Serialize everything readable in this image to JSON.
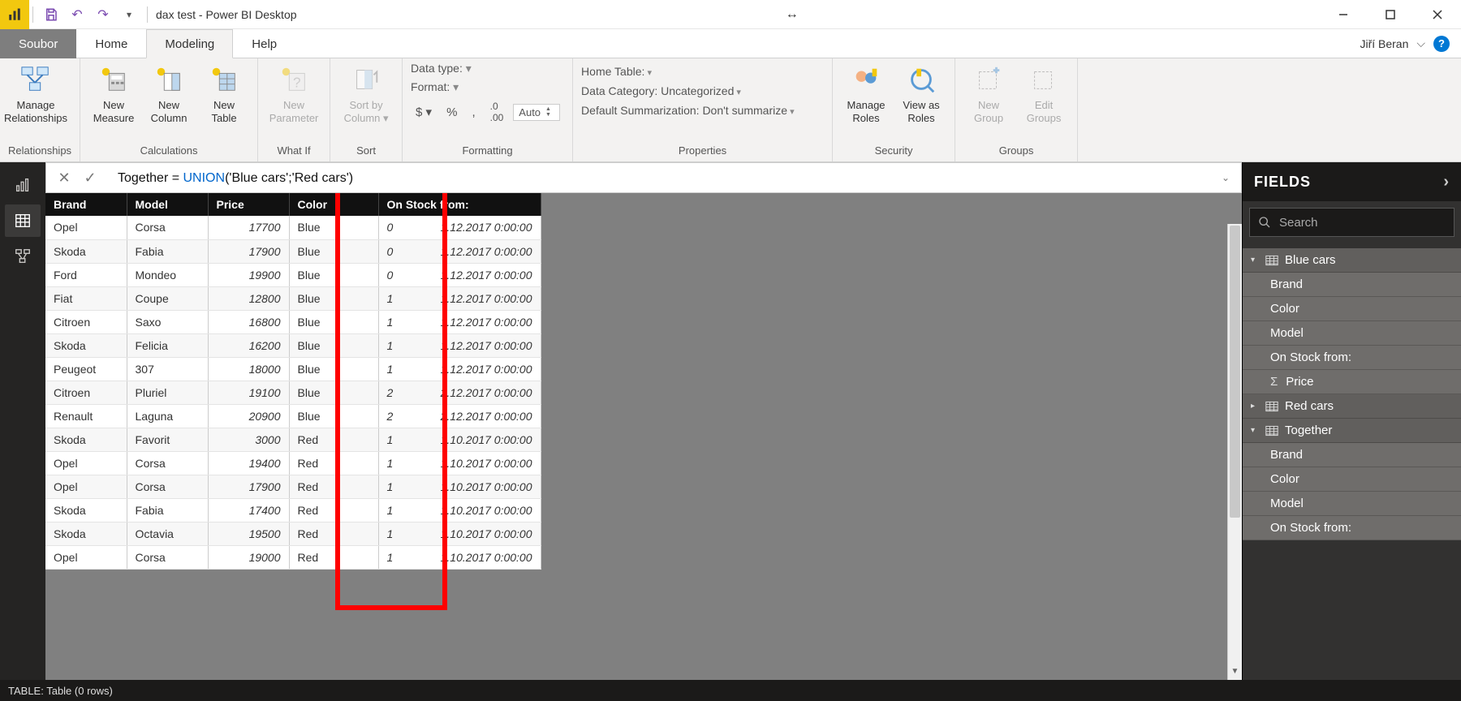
{
  "title": "dax test - Power BI Desktop",
  "user": "Jiří Beran",
  "tabs": {
    "file": "Soubor",
    "home": "Home",
    "modeling": "Modeling",
    "help": "Help"
  },
  "ribbon": {
    "relationships": {
      "manage": "Manage\nRelationships",
      "group": "Relationships"
    },
    "calc": {
      "measure": "New\nMeasure",
      "column": "New\nColumn",
      "table": "New\nTable",
      "group": "Calculations"
    },
    "whatif": {
      "param": "New\nParameter",
      "group": "What If"
    },
    "sort": {
      "btn": "Sort by\nColumn ▾",
      "group": "Sort"
    },
    "formatting": {
      "datatype": "Data type:",
      "format": "Format:",
      "auto": "Auto",
      "group": "Formatting"
    },
    "properties": {
      "hometable": "Home Table:",
      "datacat": "Data Category: Uncategorized",
      "summ": "Default Summarization: Don't summarize",
      "group": "Properties"
    },
    "security": {
      "roles": "Manage\nRoles",
      "viewas": "View as\nRoles",
      "group": "Security"
    },
    "groups": {
      "new": "New\nGroup",
      "edit": "Edit\nGroups",
      "group": "Groups"
    }
  },
  "formula": {
    "prefix": "Together = ",
    "func": "UNION",
    "args": "('Blue cars';'Red cars')"
  },
  "columns": [
    "Brand",
    "Model",
    "Price",
    "Color",
    "On Stock from:"
  ],
  "rows": [
    [
      "Opel",
      "Corsa",
      "17700",
      "Blue",
      "0",
      "1",
      "12.2017 0:00:00"
    ],
    [
      "Skoda",
      "Fabia",
      "17900",
      "Blue",
      "0",
      "1",
      "12.2017 0:00:00"
    ],
    [
      "Ford",
      "Mondeo",
      "19900",
      "Blue",
      "0",
      "1",
      "12.2017 0:00:00"
    ],
    [
      "Fiat",
      "Coupe",
      "12800",
      "Blue",
      "1",
      "1",
      "12.2017 0:00:00"
    ],
    [
      "Citroen",
      "Saxo",
      "16800",
      "Blue",
      "1",
      "1",
      "12.2017 0:00:00"
    ],
    [
      "Skoda",
      "Felicia",
      "16200",
      "Blue",
      "1",
      "1",
      "12.2017 0:00:00"
    ],
    [
      "Peugeot",
      "307",
      "18000",
      "Blue",
      "1",
      "1",
      "12.2017 0:00:00"
    ],
    [
      "Citroen",
      "Pluriel",
      "19100",
      "Blue",
      "2",
      "2",
      "12.2017 0:00:00"
    ],
    [
      "Renault",
      "Laguna",
      "20900",
      "Blue",
      "2",
      "2",
      "12.2017 0:00:00"
    ],
    [
      "Skoda",
      "Favorit",
      "3000",
      "Red",
      "1",
      "1",
      "10.2017 0:00:00"
    ],
    [
      "Opel",
      "Corsa",
      "19400",
      "Red",
      "1",
      "1",
      "10.2017 0:00:00"
    ],
    [
      "Opel",
      "Corsa",
      "17900",
      "Red",
      "1",
      "1",
      "10.2017 0:00:00"
    ],
    [
      "Skoda",
      "Fabia",
      "17400",
      "Red",
      "1",
      "1",
      "10.2017 0:00:00"
    ],
    [
      "Skoda",
      "Octavia",
      "19500",
      "Red",
      "1",
      "1",
      "10.2017 0:00:00"
    ],
    [
      "Opel",
      "Corsa",
      "19000",
      "Red",
      "1",
      "1",
      "10.2017 0:00:00"
    ]
  ],
  "fields": {
    "title": "FIELDS",
    "search": "Search",
    "tables": [
      {
        "name": "Blue cars",
        "expanded": true,
        "cols": [
          "Brand",
          "Color",
          "Model",
          "On Stock from:",
          "Price"
        ],
        "sigma": [
          "Price"
        ]
      },
      {
        "name": "Red cars",
        "expanded": false,
        "cols": []
      },
      {
        "name": "Together",
        "expanded": true,
        "cols": [
          "Brand",
          "Color",
          "Model",
          "On Stock from:"
        ],
        "sigma": []
      }
    ]
  },
  "status": "TABLE: Table (0 rows)"
}
